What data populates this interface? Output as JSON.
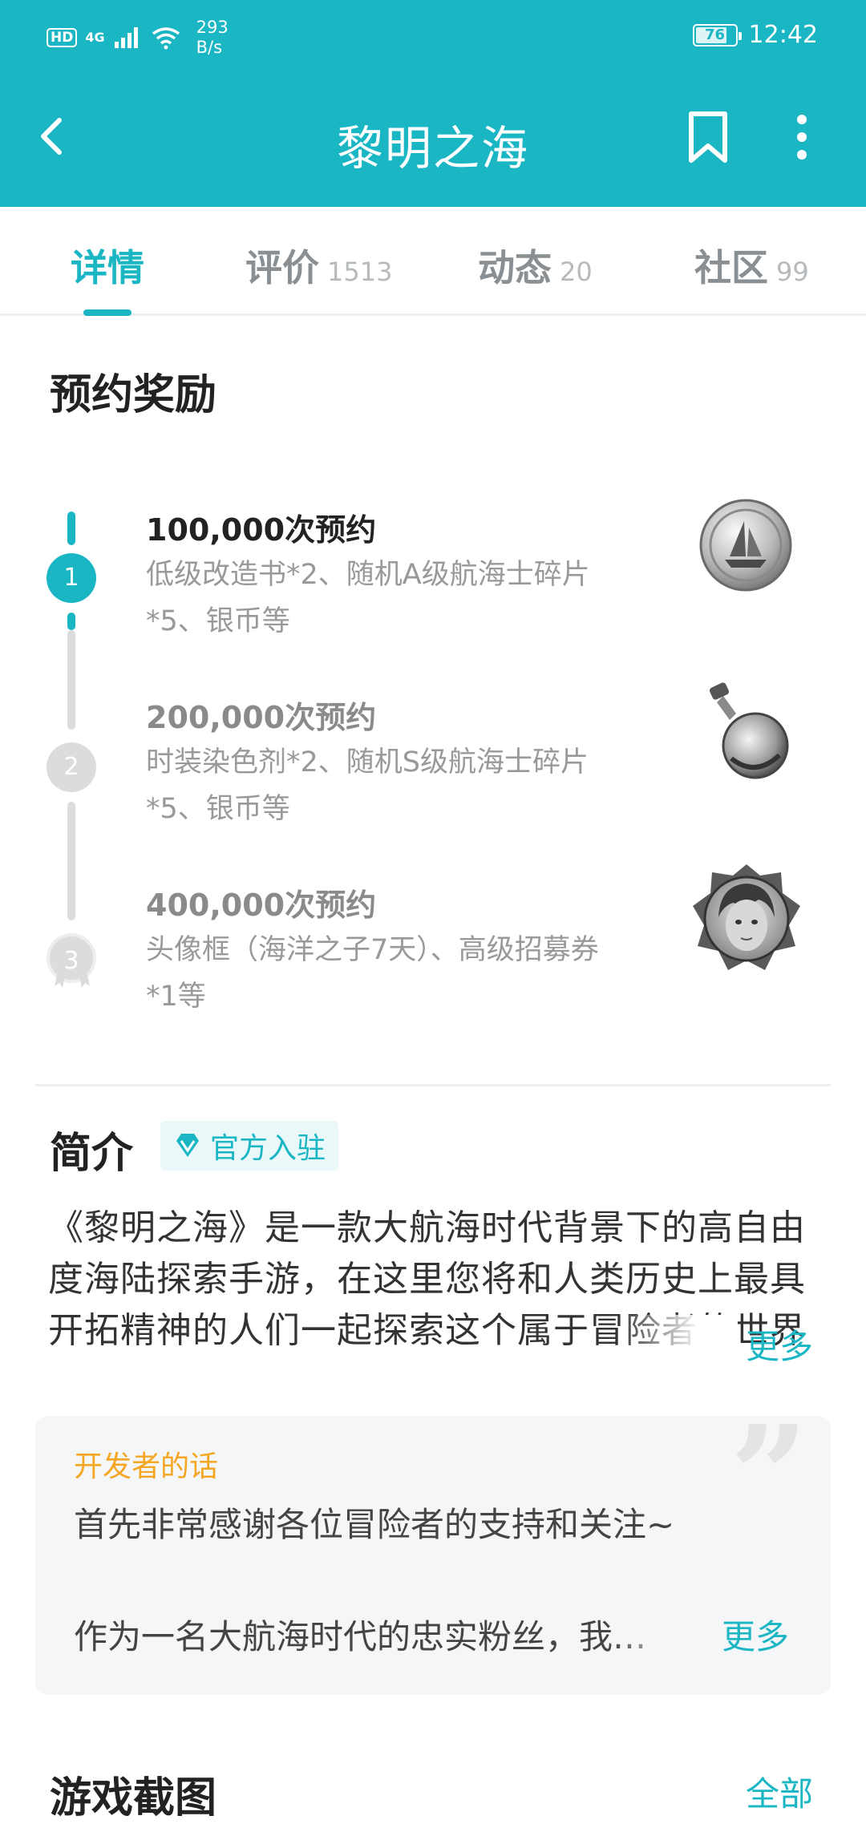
{
  "status_bar": {
    "hd": "HD",
    "network": "4G",
    "speed_value": "293",
    "speed_unit": "B/s",
    "battery": "76",
    "time": "12:42"
  },
  "header": {
    "title": "黎明之海",
    "icons": {
      "back": "back-arrow-icon",
      "bookmark": "bookmark-icon",
      "more": "more-vertical-icon"
    },
    "color": "#1bb6c4"
  },
  "tabs": [
    {
      "label": "详情",
      "count": "",
      "active": true
    },
    {
      "label": "评价",
      "count": "1513",
      "active": false
    },
    {
      "label": "动态",
      "count": "20",
      "active": false
    },
    {
      "label": "社区",
      "count": "99",
      "active": false
    }
  ],
  "rewards": {
    "title": "预约奖励",
    "items": [
      {
        "step": "1",
        "title": "100,000次预约",
        "desc": "低级改造书*2、随机A级航海士碎片*5、银币等",
        "achieved": true,
        "icon": "silver-coin-ship-icon"
      },
      {
        "step": "2",
        "title": "200,000次预约",
        "desc": "时装染色剂*2、随机S级航海士碎片*5、银币等",
        "achieved": false,
        "icon": "dye-potion-icon"
      },
      {
        "step": "3",
        "title": "400,000次预约",
        "desc": "头像框（海洋之子7天）、高级招募券*1等",
        "achieved": false,
        "icon": "avatar-frame-icon"
      }
    ]
  },
  "intro": {
    "title": "简介",
    "badge": "官方入驻",
    "text": "《黎明之海》是一款大航海时代背景下的高自由度海陆探索手游，在这里您将和人类历史上最具开拓精神的人们一起探索这个属于冒险者的世界",
    "more": "更多"
  },
  "developer": {
    "title": "开发者的话",
    "line1": "首先非常感谢各位冒险者的支持和关注~",
    "line2": "作为一名大航海时代的忠实粉丝，我…",
    "more": "更多"
  },
  "screenshots": {
    "title": "游戏截图",
    "all": "全部"
  },
  "colors": {
    "accent": "#1bb6c4",
    "orange": "#f5a623"
  }
}
